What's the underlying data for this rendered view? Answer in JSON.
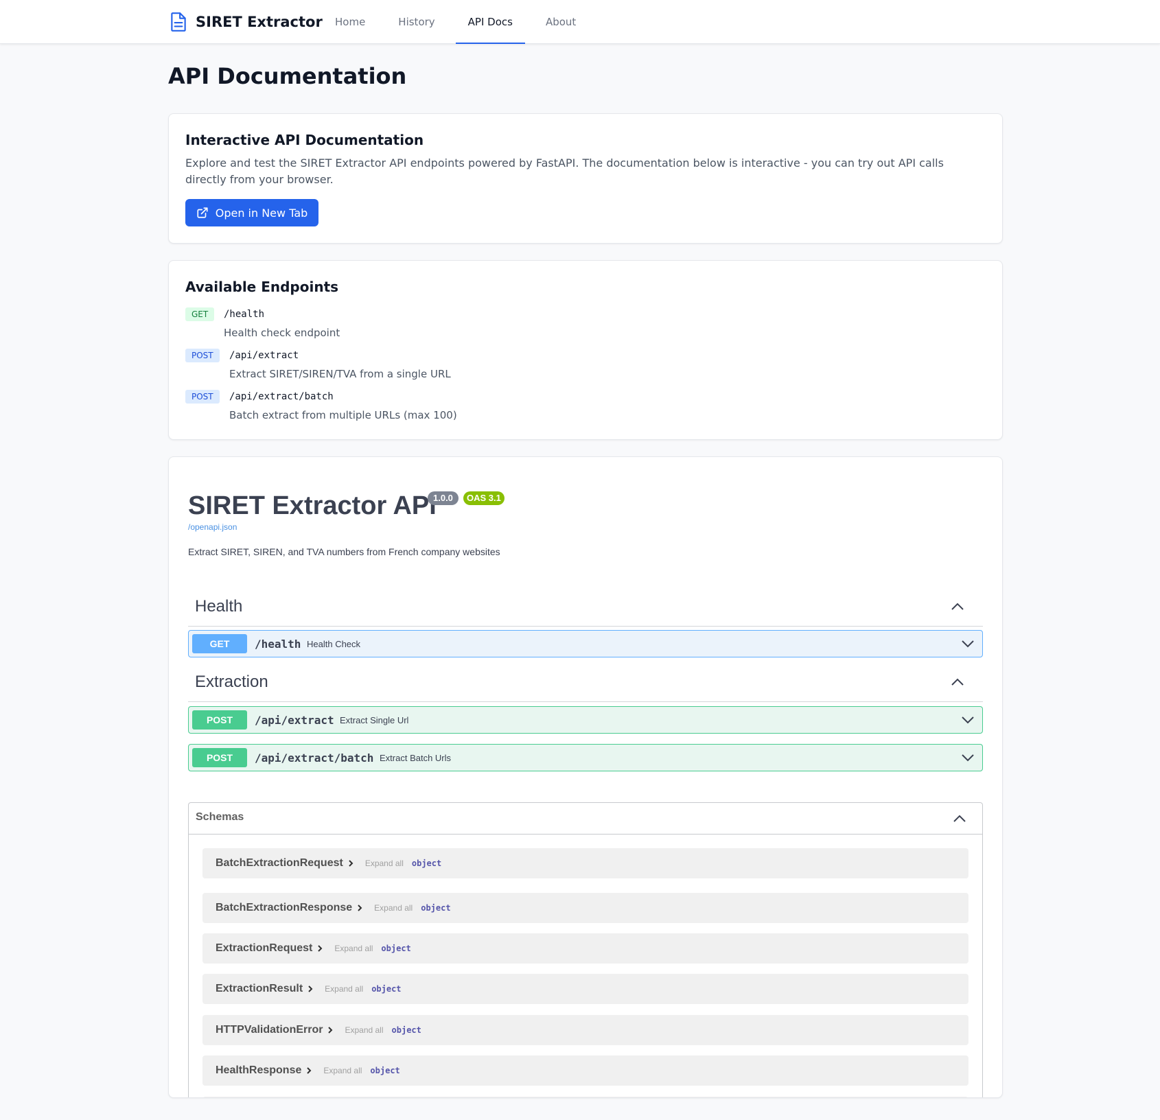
{
  "nav": {
    "brand": "SIRET Extractor",
    "links": [
      {
        "label": "Home"
      },
      {
        "label": "History"
      },
      {
        "label": "API Docs",
        "active": true
      },
      {
        "label": "About"
      }
    ]
  },
  "page": {
    "title": "API Documentation"
  },
  "intro": {
    "title": "Interactive API Documentation",
    "description": "Explore and test the SIRET Extractor API endpoints powered by FastAPI. The documentation below is interactive - you can try out API calls directly from your browser.",
    "open_button": "Open in New Tab"
  },
  "endpoints": {
    "title": "Available Endpoints",
    "items": [
      {
        "method": "GET",
        "path": "/health",
        "description": "Health check endpoint"
      },
      {
        "method": "POST",
        "path": "/api/extract",
        "description": "Extract SIRET/SIREN/TVA from a single URL"
      },
      {
        "method": "POST",
        "path": "/api/extract/batch",
        "description": "Batch extract from multiple URLs (max 100)"
      }
    ]
  },
  "swagger": {
    "title": "SIRET Extractor API",
    "version": "1.0.0",
    "oas": "OAS 3.1",
    "spec_link": "/openapi.json",
    "description": "Extract SIRET, SIREN, and TVA numbers from French company websites",
    "tags": [
      {
        "name": "Health"
      },
      {
        "name": "Extraction"
      }
    ],
    "operations": [
      {
        "method": "GET",
        "path": "/health",
        "summary": "Health Check"
      },
      {
        "method": "POST",
        "path": "/api/extract",
        "summary": "Extract Single Url"
      },
      {
        "method": "POST",
        "path": "/api/extract/batch",
        "summary": "Extract Batch Urls"
      }
    ],
    "schemas": {
      "title": "Schemas",
      "expand_label": "Expand all",
      "items": [
        {
          "name": "BatchExtractionRequest",
          "type": "object"
        },
        {
          "name": "BatchExtractionResponse",
          "type": "object"
        },
        {
          "name": "ExtractionRequest",
          "type": "object"
        },
        {
          "name": "ExtractionResult",
          "type": "object"
        },
        {
          "name": "HTTPValidationError",
          "type": "object"
        },
        {
          "name": "HealthResponse",
          "type": "object"
        }
      ]
    }
  },
  "colors": {
    "primary": "#2563eb",
    "get": "#61affe",
    "post": "#49cc90",
    "version_badge": "#7d8492",
    "oas_badge": "#89bf04"
  },
  "icons": {
    "brand": "document-icon",
    "open_button": "external-link-icon",
    "collapse": "chevron-up-icon",
    "expand": "chevron-down-icon",
    "model": "chevron-right-icon"
  }
}
